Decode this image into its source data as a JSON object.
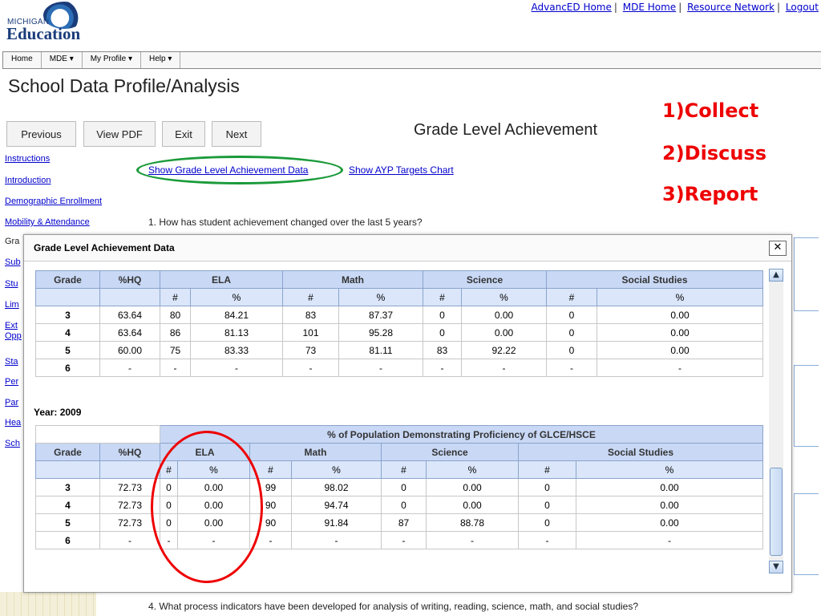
{
  "header": {
    "logo_small": "MICHIGAN",
    "logo_big": "Education",
    "links": [
      "AdvancED Home",
      "MDE Home",
      "Resource Network",
      "Logout"
    ]
  },
  "nav": [
    "Home",
    "MDE ▾",
    "My Profile ▾",
    "Help ▾"
  ],
  "page_title": "School Data Profile/Analysis",
  "buttons": {
    "previous": "Previous",
    "view_pdf": "View PDF",
    "exit": "Exit",
    "next": "Next"
  },
  "section_title": "Grade Level Achievement",
  "overlay_steps": [
    "1)Collect",
    "2)Discuss",
    "3)Report"
  ],
  "sidebar": [
    "Instructions",
    "Introduction",
    "Demographic Enrollment",
    "Mobility & Attendance",
    "Gra",
    "Sub",
    "Stu",
    "Lim",
    "Ext",
    "Opp",
    "Sta",
    "Per",
    "Par",
    "Hea",
    "Sch"
  ],
  "links": {
    "show_data": "Show Grade Level Achievement Data",
    "show_ayp": "Show AYP Targets Chart"
  },
  "question1": "1. How has student achievement changed over the last 5 years?",
  "question4": "4. What process indicators have been developed for analysis of writing, reading, science, math, and social studies?",
  "modal": {
    "title": "Grade Level Achievement Data",
    "close": "✕",
    "table1": {
      "headers": [
        "Grade",
        "%HQ",
        "ELA",
        "Math",
        "Science",
        "Social Studies"
      ],
      "sub": [
        "#",
        "%",
        "#",
        "%",
        "#",
        "%",
        "#",
        "%"
      ],
      "rows": [
        [
          "3",
          "63.64",
          "80",
          "84.21",
          "83",
          "87.37",
          "0",
          "0.00",
          "0",
          "0.00"
        ],
        [
          "4",
          "63.64",
          "86",
          "81.13",
          "101",
          "95.28",
          "0",
          "0.00",
          "0",
          "0.00"
        ],
        [
          "5",
          "60.00",
          "75",
          "83.33",
          "73",
          "81.11",
          "83",
          "92.22",
          "0",
          "0.00"
        ],
        [
          "6",
          "-",
          "-",
          "-",
          "-",
          "-",
          "-",
          "-",
          "-",
          "-"
        ]
      ]
    },
    "year_label": "Year: 2009",
    "table2": {
      "super_header": "% of Population Demonstrating Proficiency of GLCE/HSCE",
      "headers": [
        "Grade",
        "%HQ",
        "ELA",
        "Math",
        "Science",
        "Social Studies"
      ],
      "sub": [
        "#",
        "%",
        "#",
        "%",
        "#",
        "%",
        "#",
        "%"
      ],
      "rows": [
        [
          "3",
          "72.73",
          "0",
          "0.00",
          "99",
          "98.02",
          "0",
          "0.00",
          "0",
          "0.00"
        ],
        [
          "4",
          "72.73",
          "0",
          "0.00",
          "90",
          "94.74",
          "0",
          "0.00",
          "0",
          "0.00"
        ],
        [
          "5",
          "72.73",
          "0",
          "0.00",
          "90",
          "91.84",
          "87",
          "88.78",
          "0",
          "0.00"
        ],
        [
          "6",
          "-",
          "-",
          "-",
          "-",
          "-",
          "-",
          "-",
          "-",
          "-"
        ]
      ]
    }
  }
}
